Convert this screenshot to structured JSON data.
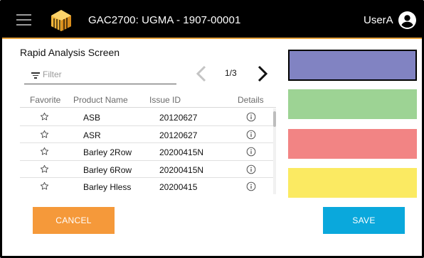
{
  "header": {
    "title": "GAC2700: UGMA - 1907-00001",
    "user": "UserA"
  },
  "screen": {
    "title": "Rapid Analysis Screen"
  },
  "filter": {
    "placeholder": "Filter",
    "value": ""
  },
  "pager": {
    "text": "1/3"
  },
  "table": {
    "headers": {
      "favorite": "Favorite",
      "product_name": "Product Name",
      "issue_id": "Issue ID",
      "details": "Details"
    },
    "rows": [
      {
        "favorite": false,
        "product_name": "ASB",
        "issue_id": "20120627"
      },
      {
        "favorite": false,
        "product_name": "ASR",
        "issue_id": "20120627"
      },
      {
        "favorite": false,
        "product_name": "Barley 2Row",
        "issue_id": "20200415N"
      },
      {
        "favorite": false,
        "product_name": "Barley 6Row",
        "issue_id": "20200415N"
      },
      {
        "favorite": false,
        "product_name": "Barley Hless",
        "issue_id": "20200415"
      }
    ]
  },
  "buttons": {
    "cancel": "CANCEL",
    "save": "SAVE"
  },
  "swatches": [
    {
      "color": "#8183c2",
      "selected": true
    },
    {
      "color": "#9dd394",
      "selected": false
    },
    {
      "color": "#f28484",
      "selected": false
    },
    {
      "color": "#fbea62",
      "selected": false
    }
  ],
  "colors": {
    "header_bg": "#000000",
    "header_accent": "#e6a23c",
    "cancel": "#f5993a",
    "save": "#0aa8dc"
  },
  "icons": {
    "menu": "hamburger-menu-icon",
    "logo": "logo-icon",
    "user": "account-circle-icon",
    "filter": "filter-icon",
    "prev": "chevron-left-icon",
    "next": "chevron-right-icon",
    "favorite": "star-outline-icon",
    "details": "info-circle-icon"
  }
}
